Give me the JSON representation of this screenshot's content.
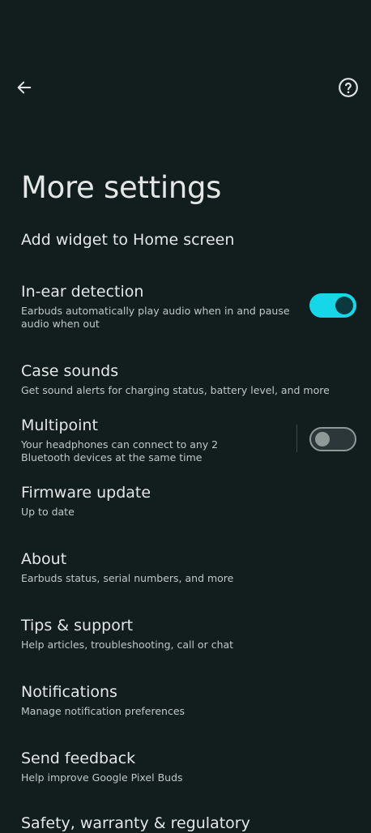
{
  "page": {
    "title": "More settings"
  },
  "colors": {
    "background": "#121d1e",
    "accent": "#16d7e8",
    "text": "#e3e8e7",
    "subtext": "#bfc8c7"
  },
  "icons": {
    "back": "arrow-left-icon",
    "help": "question-circle-icon"
  },
  "items": [
    {
      "title": "Add widget to Home screen",
      "subtitle": ""
    },
    {
      "title": "In-ear detection",
      "subtitle": "Earbuds automatically play audio when in and pause audio when out",
      "toggle": true
    },
    {
      "title": "Case sounds",
      "subtitle": "Get sound alerts for charging status, battery level, and more"
    },
    {
      "title": "Multipoint",
      "subtitle": "Your headphones can connect to any 2 Bluetooth devices at the same time",
      "toggle": false
    },
    {
      "title": "Firmware update",
      "subtitle": "Up to date"
    },
    {
      "title": "About",
      "subtitle": "Earbuds status, serial numbers, and more"
    },
    {
      "title": "Tips & support",
      "subtitle": "Help articles, troubleshooting, call or chat"
    },
    {
      "title": "Notifications",
      "subtitle": "Manage notification preferences"
    },
    {
      "title": "Send feedback",
      "subtitle": "Help improve Google Pixel Buds"
    },
    {
      "title": "Safety, warranty & regulatory",
      "subtitle": ""
    }
  ]
}
